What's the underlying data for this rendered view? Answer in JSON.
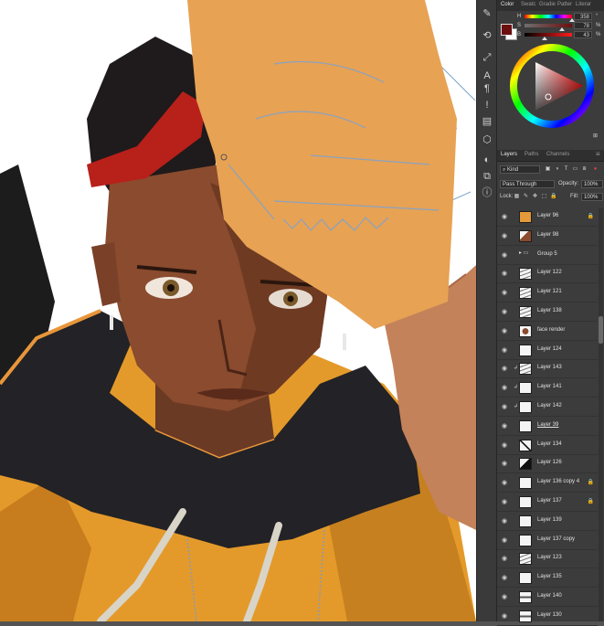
{
  "color_panel": {
    "tabs": [
      "Color",
      "Swatc",
      "Gradie",
      "Patter",
      "Literar"
    ],
    "sliders": [
      {
        "label": "H",
        "value": "358",
        "unit": "°"
      },
      {
        "label": "S",
        "value": "78",
        "unit": "%"
      },
      {
        "label": "B",
        "value": "43",
        "unit": "%"
      }
    ],
    "foreground_color": "#6b0f0f",
    "background_color": "#ffffff"
  },
  "layers_panel": {
    "tabs": [
      "Layers",
      "Paths",
      "Channels"
    ],
    "filter_kind": "Kind",
    "blend_mode": "Pass Through",
    "opacity_label": "Opacity:",
    "opacity_value": "100%",
    "lock_label": "Lock:",
    "fill_label": "Fill:",
    "fill_value": "100%",
    "layers": [
      {
        "name": "Layer 96",
        "locked": true,
        "visible": true,
        "thumb": "orange",
        "underline": false
      },
      {
        "name": "Layer 98",
        "locked": false,
        "visible": true,
        "thumb": "brown",
        "underline": false
      },
      {
        "name": "Group 5",
        "locked": false,
        "visible": true,
        "thumb": "folder",
        "underline": false
      },
      {
        "name": "Layer 122",
        "locked": false,
        "visible": true,
        "thumb": "lines",
        "underline": false
      },
      {
        "name": "Layer 121",
        "locked": false,
        "visible": true,
        "thumb": "lines",
        "underline": false
      },
      {
        "name": "Layer 138",
        "locked": false,
        "visible": true,
        "thumb": "lines",
        "underline": false
      },
      {
        "name": "face render",
        "locked": false,
        "visible": true,
        "thumb": "face",
        "underline": false
      },
      {
        "name": "Layer 124",
        "locked": false,
        "visible": true,
        "thumb": "blank",
        "underline": false
      },
      {
        "name": "Layer 143",
        "locked": false,
        "visible": true,
        "thumb": "lines",
        "underline": false,
        "clipped": true
      },
      {
        "name": "Layer 141",
        "locked": false,
        "visible": true,
        "thumb": "blank",
        "underline": false,
        "clipped": true
      },
      {
        "name": "Layer 142",
        "locked": false,
        "visible": true,
        "thumb": "blank",
        "underline": false,
        "clipped": true
      },
      {
        "name": "Layer 39",
        "locked": false,
        "visible": true,
        "thumb": "blank",
        "underline": true
      },
      {
        "name": "Layer 134",
        "locked": false,
        "visible": true,
        "thumb": "diag",
        "underline": false
      },
      {
        "name": "Layer 126",
        "locked": false,
        "visible": true,
        "thumb": "dark",
        "underline": false
      },
      {
        "name": "Layer 136 copy 4",
        "locked": true,
        "visible": true,
        "thumb": "blank",
        "underline": false
      },
      {
        "name": "Layer 137",
        "locked": true,
        "visible": true,
        "thumb": "blank",
        "underline": false
      },
      {
        "name": "Layer 139",
        "locked": false,
        "visible": true,
        "thumb": "blank",
        "underline": false
      },
      {
        "name": "Layer 137 copy",
        "locked": false,
        "visible": true,
        "thumb": "blank",
        "underline": false
      },
      {
        "name": "Layer 123",
        "locked": false,
        "visible": true,
        "thumb": "lines",
        "underline": false
      },
      {
        "name": "Layer 135",
        "locked": false,
        "visible": true,
        "thumb": "blank",
        "underline": false
      },
      {
        "name": "Layer 140",
        "locked": false,
        "visible": true,
        "thumb": "strip",
        "underline": false
      },
      {
        "name": "Layer 130",
        "locked": false,
        "visible": true,
        "thumb": "strip",
        "underline": false
      }
    ]
  },
  "tools": [
    "brush-preset-icon",
    "history-icon",
    "transform-icon",
    "adjust-icon",
    "3d-icon",
    "glyph-icon",
    "paragraph-icon",
    "character-icon",
    "library-icon",
    "info-icon",
    "layer-comps-icon"
  ]
}
